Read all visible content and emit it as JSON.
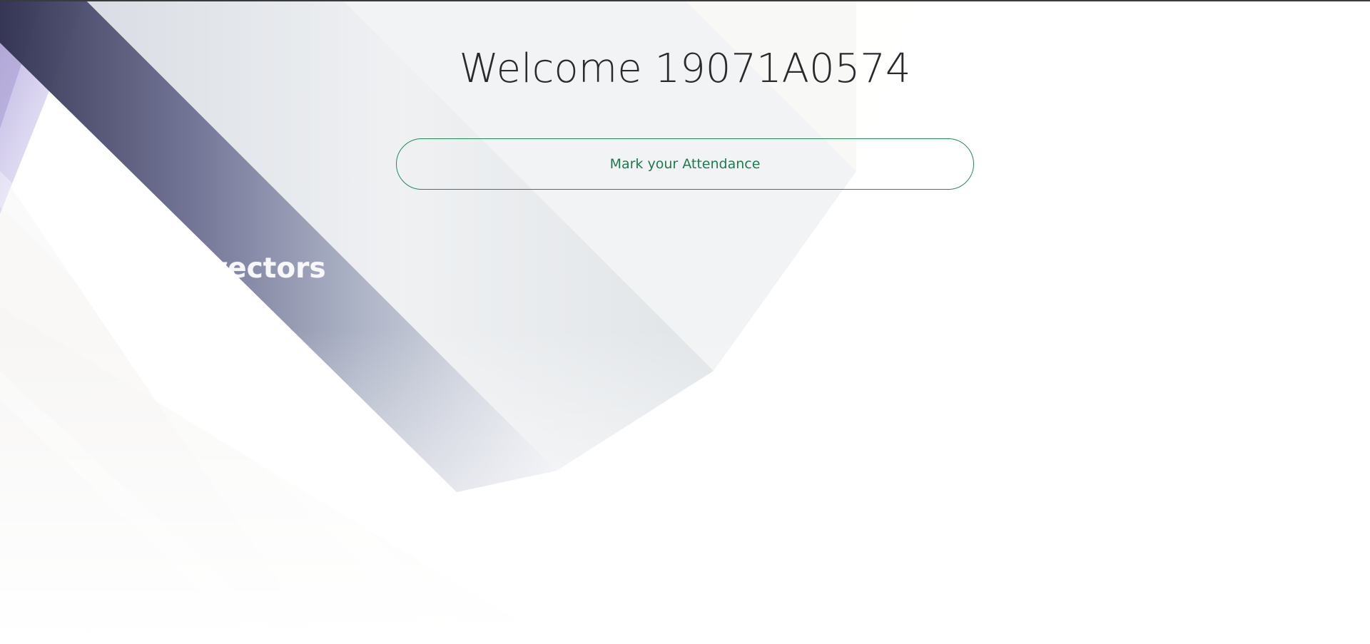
{
  "page": {
    "welcome_text": "Welcome 19071A0574",
    "watermark_text": "123Freevectors"
  },
  "actions": {
    "mark_attendance_label": "Mark your Attendance"
  },
  "colors": {
    "accent": "#1e8c5a",
    "heading": "#2a2a2e",
    "background": "#ffffff"
  }
}
